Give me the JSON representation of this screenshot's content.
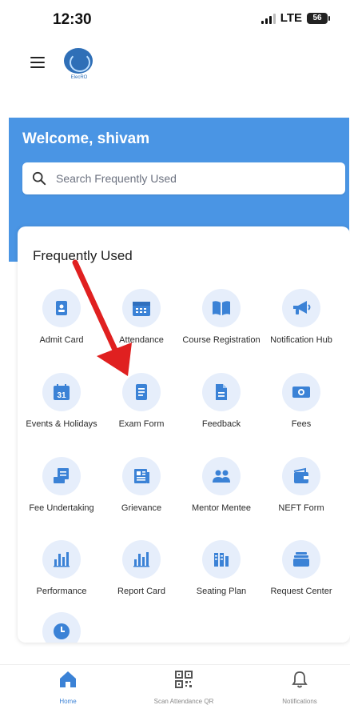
{
  "status": {
    "time": "12:30",
    "network": "LTE",
    "battery": "56"
  },
  "header": {
    "logo_text": "ElecRO"
  },
  "welcome": {
    "text": "Welcome, shivam"
  },
  "search": {
    "placeholder": "Search Frequently Used"
  },
  "section": {
    "title": "Frequently Used"
  },
  "tiles": [
    {
      "label": "Admit Card",
      "icon": "id-card-icon"
    },
    {
      "label": "Attendance",
      "icon": "calendar-grid-icon"
    },
    {
      "label": "Course Registration",
      "icon": "book-icon"
    },
    {
      "label": "Notification Hub",
      "icon": "megaphone-icon"
    },
    {
      "label": "Events & Holidays",
      "icon": "calendar-31-icon"
    },
    {
      "label": "Exam Form",
      "icon": "document-icon"
    },
    {
      "label": "Feedback",
      "icon": "file-icon"
    },
    {
      "label": "Fees",
      "icon": "money-icon"
    },
    {
      "label": "Fee Undertaking",
      "icon": "receipt-icon"
    },
    {
      "label": "Grievance",
      "icon": "newspaper-icon"
    },
    {
      "label": "Mentor Mentee",
      "icon": "people-icon"
    },
    {
      "label": "NEFT Form",
      "icon": "wallet-icon"
    },
    {
      "label": "Performance",
      "icon": "bar-chart-icon"
    },
    {
      "label": "Report Card",
      "icon": "bar-chart-icon"
    },
    {
      "label": "Seating Plan",
      "icon": "seating-icon"
    },
    {
      "label": "Request Center",
      "icon": "stack-icon"
    }
  ],
  "bottom_nav": [
    {
      "label": "Home",
      "icon": "home-icon"
    },
    {
      "label": "Scan Attendance QR",
      "icon": "qr-code-icon"
    },
    {
      "label": "Notifications",
      "icon": "bell-icon"
    }
  ],
  "colors": {
    "brand_blue": "#4a95e4",
    "icon_blue": "#3b82d6",
    "bubble_bg": "#e6eefb",
    "annotation_arrow": "#e02020"
  }
}
